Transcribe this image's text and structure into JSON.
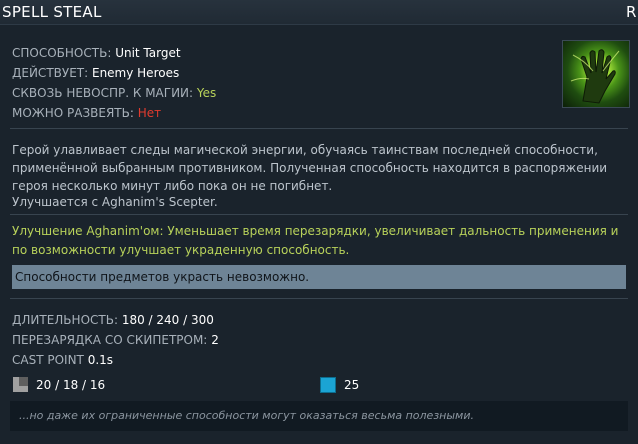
{
  "title": "SPELL STEAL",
  "hotkey": "R",
  "icon": "spell-steal-hand-icon",
  "stats": [
    {
      "key": "СПОСОБНОСТЬ:",
      "value": "Unit Target",
      "tone": "white"
    },
    {
      "key": "ДЕЙСТВУЕТ:",
      "value": "Enemy Heroes",
      "tone": "white"
    },
    {
      "key": "СКВОЗЬ НЕВОСПР. К МАГИИ:",
      "value": "Yes",
      "tone": "yes"
    },
    {
      "key": "МОЖНО РАЗВЕЯТЬ:",
      "value": "Нет",
      "tone": "no"
    }
  ],
  "lore": "Герой улавливает следы магической энергии, обучаясь таинствам последней способности, применённой выбранным противником. Полученная способность находится в распоряжении героя несколько минут либо пока он не погибнет.",
  "upgrade": "Улучшается с Aghanim's Scepter.",
  "aghs": "Улучшение Aghanim'ом: Уменьшает время перезарядки, увеличивает дальность применения и по возможности улучшает украденную способность.",
  "note": "Способности предметов украсть невозможно.",
  "attributes": [
    {
      "key": "ДЛИТЕЛЬНОСТЬ:",
      "value": "180 / 240 / 300"
    },
    {
      "key": "ПЕРЕЗАРЯДКА СО СКИПЕТРОМ:",
      "value": "2"
    },
    {
      "key": "CAST POINT",
      "value": "0.1s"
    }
  ],
  "cooldown": "20 / 18 / 16",
  "mana": "25",
  "quote": "...но даже их ограниченные способности могут оказаться весьма полезными.",
  "colors": {
    "green": "#b8d25a",
    "red": "#e03b2e",
    "mana": "#1ba4d4",
    "note_bar": "#6e8496"
  }
}
